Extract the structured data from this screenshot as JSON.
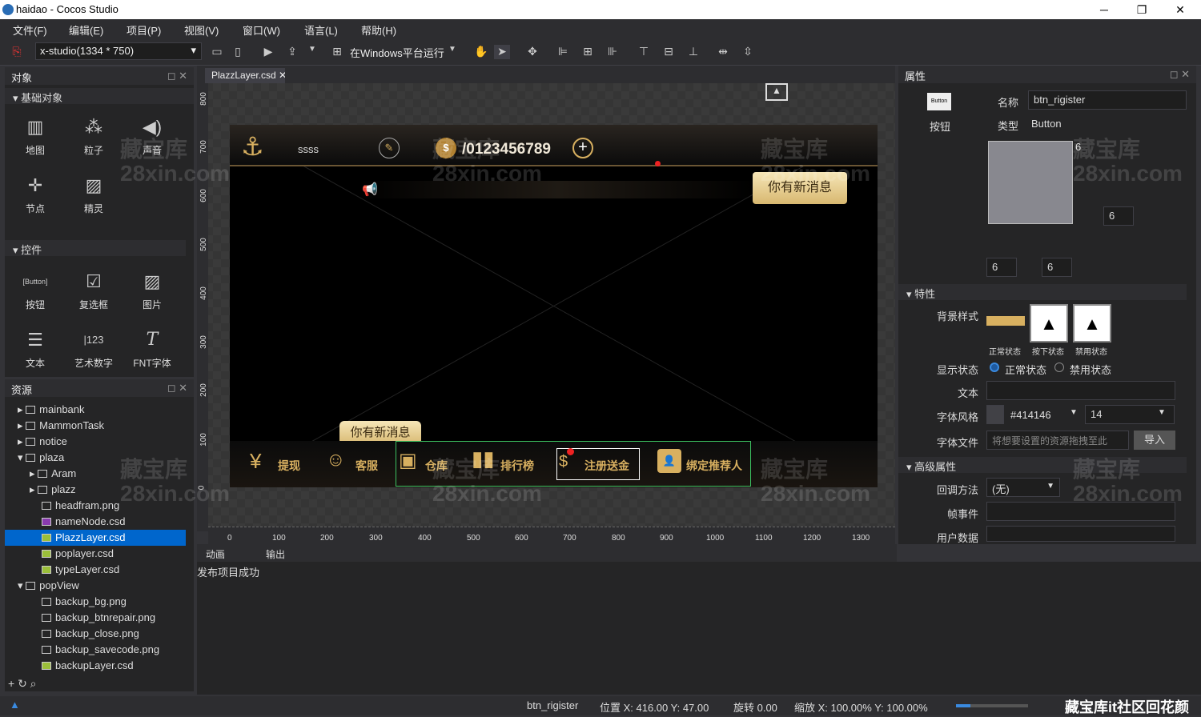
{
  "window": {
    "title": "haidao - Cocos Studio",
    "minimize": "─",
    "maximize": "❐",
    "close": "✕"
  },
  "menu": [
    "文件(F)",
    "编辑(E)",
    "项目(P)",
    "视图(V)",
    "窗口(W)",
    "语言(L)",
    "帮助(H)"
  ],
  "toolbar": {
    "resolution": "x-studio(1334 * 750)",
    "run_label": "在Windows平台运行"
  },
  "objects_panel": {
    "title": "对象",
    "basic_section": "基础对象",
    "basic": [
      "地图",
      "粒子",
      "声音",
      "节点",
      "精灵"
    ],
    "controls_section": "控件",
    "controls": [
      "按钮",
      "复选框",
      "图片",
      "文本",
      "艺术数字",
      "FNT字体"
    ]
  },
  "resources_panel": {
    "title": "资源",
    "tree": [
      "mainbank",
      "MammonTask",
      "notice",
      "plaza",
      "Aram",
      "plazz",
      "headfram.png",
      "nameNode.csd",
      "PlazzLayer.csd",
      "poplayer.csd",
      "typeLayer.csd",
      "popView",
      "backup_bg.png",
      "backup_btnrepair.png",
      "backup_close.png",
      "backup_savecode.png",
      "backupLayer.csd"
    ]
  },
  "editor": {
    "tab": "PlazzLayer.csd",
    "ruler_x": [
      "0",
      "100",
      "200",
      "300",
      "400",
      "500",
      "600",
      "700",
      "800",
      "900",
      "1000",
      "1100",
      "1200",
      "1300"
    ],
    "ruler_y": [
      "800",
      "700",
      "600",
      "500",
      "400",
      "300",
      "200",
      "100",
      "0"
    ]
  },
  "game": {
    "username": "ssss",
    "coins": "/0123456789",
    "message": "你有新消息",
    "message2": "你有新消息",
    "bottom": [
      "提现",
      "客服",
      "仓库",
      "排行榜",
      "注册送金",
      "绑定推荐人"
    ]
  },
  "bottom_panel": {
    "tabs": [
      "动画",
      "输出"
    ],
    "output": "发布项目成功"
  },
  "properties": {
    "title": "属性",
    "widget_icon": "Button",
    "widget_label": "按钮",
    "name_label": "名称",
    "name_value": "btn_rigister",
    "type_label": "类型",
    "type_value": "Button",
    "margin_top": "6",
    "margin_right": "6",
    "margin_bottom_left": "6",
    "margin_bottom_right": "6",
    "features_section": "特性",
    "bg_style_label": "背景样式",
    "states": [
      "正常状态",
      "按下状态",
      "禁用状态"
    ],
    "display_label": "显示状态",
    "display_normal": "正常状态",
    "display_disabled": "禁用状态",
    "text_label": "文本",
    "font_style_label": "字体风格",
    "font_color": "#414146",
    "font_size": "14",
    "font_file_label": "字体文件",
    "font_file_placeholder": "将想要设置的资源拖拽至此",
    "import_button": "导入",
    "advanced_section": "高级属性",
    "callback_label": "回调方法",
    "callback_value": "(无)",
    "frame_event_label": "帧事件",
    "user_data_label": "用户数据"
  },
  "status": {
    "node": "btn_rigister",
    "pos": "位置 X: 416.00  Y: 47.00",
    "rotation": "旋转 0.00",
    "scale": "缩放 X: 100.00%  Y: 100.00%"
  },
  "watermark": {
    "line1": "藏宝库",
    "line2": "28xin.com",
    "footer": "藏宝库it社区回花颜"
  },
  "colors": {
    "selection": "#0066cc",
    "accent_green": "#3cc060",
    "gold": "#d8b060"
  }
}
